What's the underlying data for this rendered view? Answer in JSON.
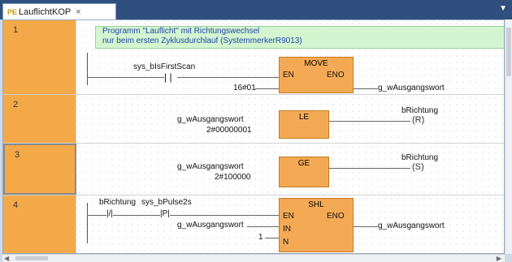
{
  "tab": {
    "icon": "lad-icon",
    "icon_text": "PE",
    "label": "LauflichtKOP",
    "close": "×"
  },
  "networks": [
    {
      "number": "1",
      "comment": [
        "Programm \"Lauflicht\" mit Richtungswechsel",
        "nur beim ersten Zyklusdurchlauf (SystemmerkerR9013)"
      ],
      "contact_label": "sys_bIsFirstScan",
      "block_title": "MOVE",
      "en": "EN",
      "eno": "ENO",
      "input": "16#01",
      "output": "g_wAusgangswort"
    },
    {
      "number": "2",
      "block_title": "LE",
      "input1": "g_wAusgangswort",
      "input2": "2#00000001",
      "coil_var": "bRichtung",
      "coil": "(R)"
    },
    {
      "number": "3",
      "block_title": "GE",
      "input1": "g_wAusgangswort",
      "input2": "2#100000",
      "coil_var": "bRichtung",
      "coil": "(S)"
    },
    {
      "number": "4",
      "contact1": "bRichtung",
      "contact1_sym": "|/|",
      "contact2": "sys_bPulse2s",
      "contact2_sym": "|P|",
      "block_title": "SHL",
      "en": "EN",
      "eno": "ENO",
      "in": "IN",
      "n": "N",
      "input1": "g_wAusgangswort",
      "input2": "1",
      "output": "g_wAusgangswort"
    }
  ]
}
